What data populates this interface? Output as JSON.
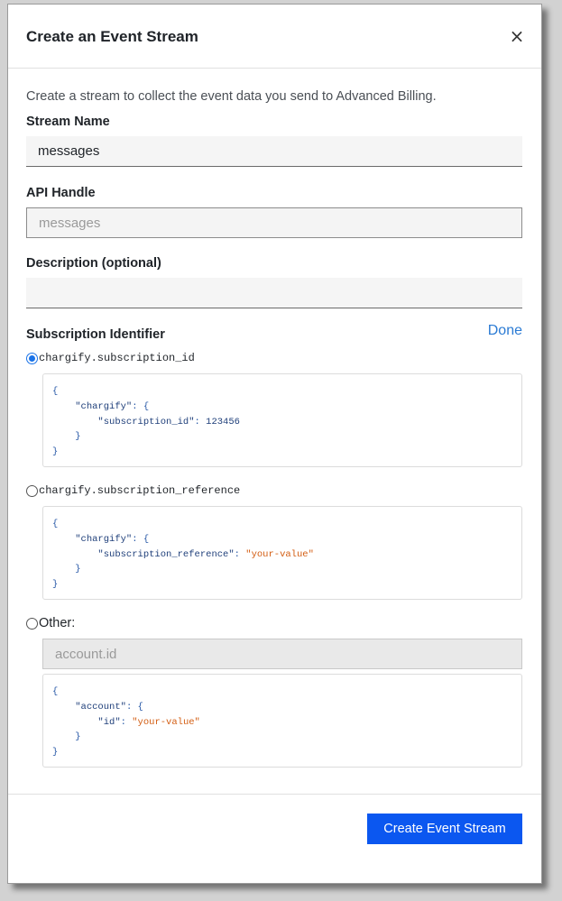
{
  "modal": {
    "title": "Create an Event Stream",
    "close_glyph": "×",
    "intro": "Create a stream to collect the event data you send to Advanced Billing."
  },
  "fields": {
    "stream_name": {
      "label": "Stream Name",
      "value": "messages"
    },
    "api_handle": {
      "label": "API Handle",
      "placeholder": "messages"
    },
    "description": {
      "label": "Description (optional)",
      "value": ""
    }
  },
  "subscription_identifier": {
    "label": "Subscription Identifier",
    "done_label": "Done",
    "options": [
      {
        "label": "chargify.subscription_id",
        "selected": true,
        "code": {
          "open": "{",
          "outer_key": "\"chargify\"",
          "inner_key": "\"subscription_id\"",
          "inner_value": "123456",
          "close_inner": "}",
          "close": "}"
        }
      },
      {
        "label": "chargify.subscription_reference",
        "selected": false,
        "code": {
          "open": "{",
          "outer_key": "\"chargify\"",
          "inner_key": "\"subscription_reference\"",
          "inner_value": "\"your-value\"",
          "close_inner": "}",
          "close": "}"
        }
      },
      {
        "label": "Other:",
        "selected": false,
        "input_placeholder": "account.id",
        "code": {
          "open": "{",
          "outer_key": "\"account\"",
          "inner_key": "\"id\"",
          "inner_value": "\"your-value\"",
          "close_inner": "}",
          "close": "}"
        }
      }
    ]
  },
  "footer": {
    "submit_label": "Create Event Stream"
  },
  "colors": {
    "accent": "#0b57f0",
    "link": "#2b7bd4",
    "code_string": "#d35d12",
    "code_key": "#1f3f7a"
  },
  "icons": {
    "close": "close-icon"
  }
}
